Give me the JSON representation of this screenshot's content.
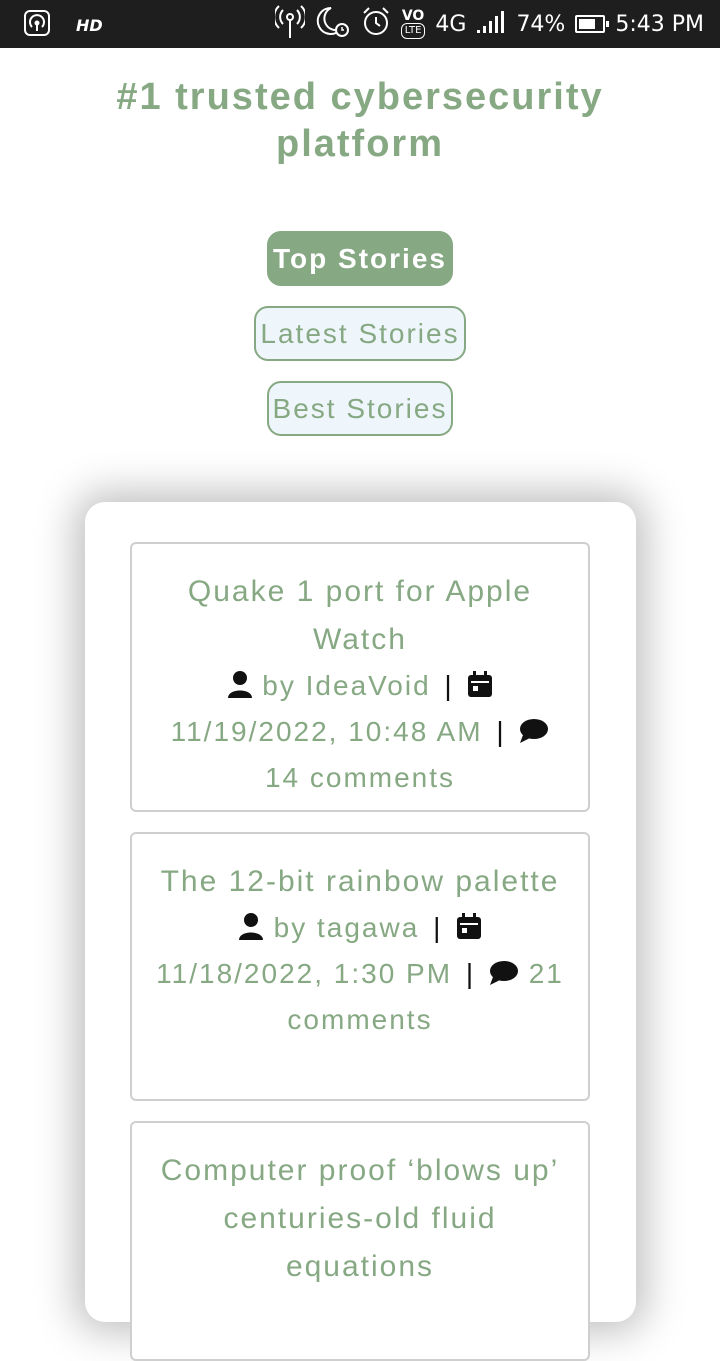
{
  "status_bar": {
    "hd_label": "HD",
    "network_label": "4G",
    "volte_label": "VO",
    "lte_label": "LTE",
    "battery_percent": "74%",
    "battery_level": 0.74,
    "time": "5:43 PM"
  },
  "page": {
    "headline": "#1 trusted cybersecurity platform"
  },
  "nav": {
    "top": "Top Stories",
    "latest": "Latest Stories",
    "best": "Best Stories",
    "active": "top"
  },
  "stories": [
    {
      "title": "Quake 1 port for Apple Watch",
      "author": "by IdeaVoid",
      "date": "11/19/2022, 10:48 AM",
      "comments": "14 comments"
    },
    {
      "title": "The 12-bit rainbow palette",
      "author": "by tagawa",
      "date": "11/18/2022, 1:30 PM",
      "comments": "21 comments"
    },
    {
      "title": "Computer proof ‘blows up’ centuries-old fluid equations"
    }
  ],
  "separator": "|",
  "icons": [
    "hotspot-icon",
    "broadcast-icon",
    "moon-clock-icon",
    "alarm-icon",
    "signal-icon",
    "battery-icon",
    "user-icon",
    "calendar-icon",
    "comment-icon"
  ],
  "colors": {
    "accent": "#86a883",
    "button_bg": "#eef6fb",
    "status_bar": "#1e1e1e"
  }
}
